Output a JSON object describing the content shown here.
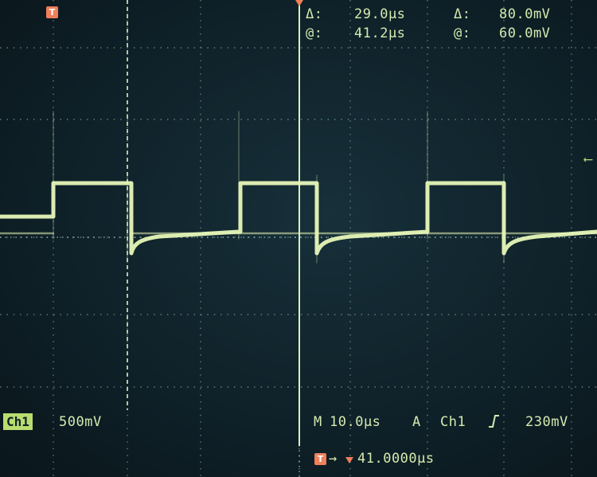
{
  "scope": {
    "trigger_marker_label": "T",
    "cursor_time": {
      "delta_label": "Δ:",
      "delta_value": "29.0µs",
      "at_label": "@:",
      "at_value": "41.2µs"
    },
    "cursor_volt": {
      "delta_label": "Δ:",
      "delta_value": "80.0mV",
      "at_label": "@:",
      "at_value": "60.0mV"
    },
    "channel": {
      "name": "Ch1",
      "volts_per_div": "500mV"
    },
    "timebase": {
      "mode_label": "M",
      "sec_per_div": "10.0µs",
      "trigger_mode": "A",
      "trigger_source": "Ch1",
      "trigger_level": "230mV"
    },
    "trigger_position": {
      "label": "T",
      "value": "41.0000µs"
    },
    "colors": {
      "trace": "#e7f7b8",
      "grid": "#6f8f8a",
      "cursor": "#d9f0c0",
      "trigger": "#f07f5a",
      "badge": "#b9dd6e"
    }
  },
  "icons": {
    "trigger-slope": "rising-edge-icon",
    "level-marker": "left-arrow-icon"
  }
}
